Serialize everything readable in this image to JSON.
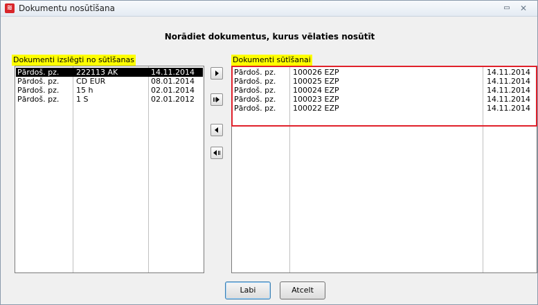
{
  "window": {
    "title": "Dokumentu nosūtīšana"
  },
  "heading": "Norādiet dokumentus, kurus vēlaties nosūtīt",
  "left": {
    "label": "Dokumenti izslēgti no sūtīšanas",
    "rows": [
      {
        "type": "Pārdoš. pz.",
        "number": "222113 AK",
        "date": "14.11.2014",
        "selected": true
      },
      {
        "type": "Pārdoš. pz.",
        "number": "CD EUR",
        "date": "08.01.2014",
        "selected": false
      },
      {
        "type": "Pārdoš. pz.",
        "number": "15 h",
        "date": "02.01.2014",
        "selected": false
      },
      {
        "type": "Pārdoš. pz.",
        "number": "1 S",
        "date": "02.01.2012",
        "selected": false
      }
    ]
  },
  "right": {
    "label": "Dokumenti sūtīšanai",
    "rows": [
      {
        "type": "Pārdoš. pz.",
        "number": "100026 EZP",
        "date": "14.11.2014"
      },
      {
        "type": "Pārdoš. pz.",
        "number": "100025 EZP",
        "date": "14.11.2014"
      },
      {
        "type": "Pārdoš. pz.",
        "number": "100024 EZP",
        "date": "14.11.2014"
      },
      {
        "type": "Pārdoš. pz.",
        "number": "100023 EZP",
        "date": "14.11.2014"
      },
      {
        "type": "Pārdoš. pz.",
        "number": "100022 EZP",
        "date": "14.11.2014"
      }
    ]
  },
  "buttons": {
    "ok": "Labi",
    "cancel": "Atcelt"
  },
  "icons": {
    "app": "app-logo-icon",
    "move_right": "arrow-right-icon",
    "move_all_right": "arrow-right-all-icon",
    "move_left": "arrow-left-icon",
    "move_all_left": "arrow-left-all-icon"
  },
  "colors": {
    "label_highlight": "#ffff00",
    "annotation_box": "#e0202a",
    "selection": "#000000"
  }
}
